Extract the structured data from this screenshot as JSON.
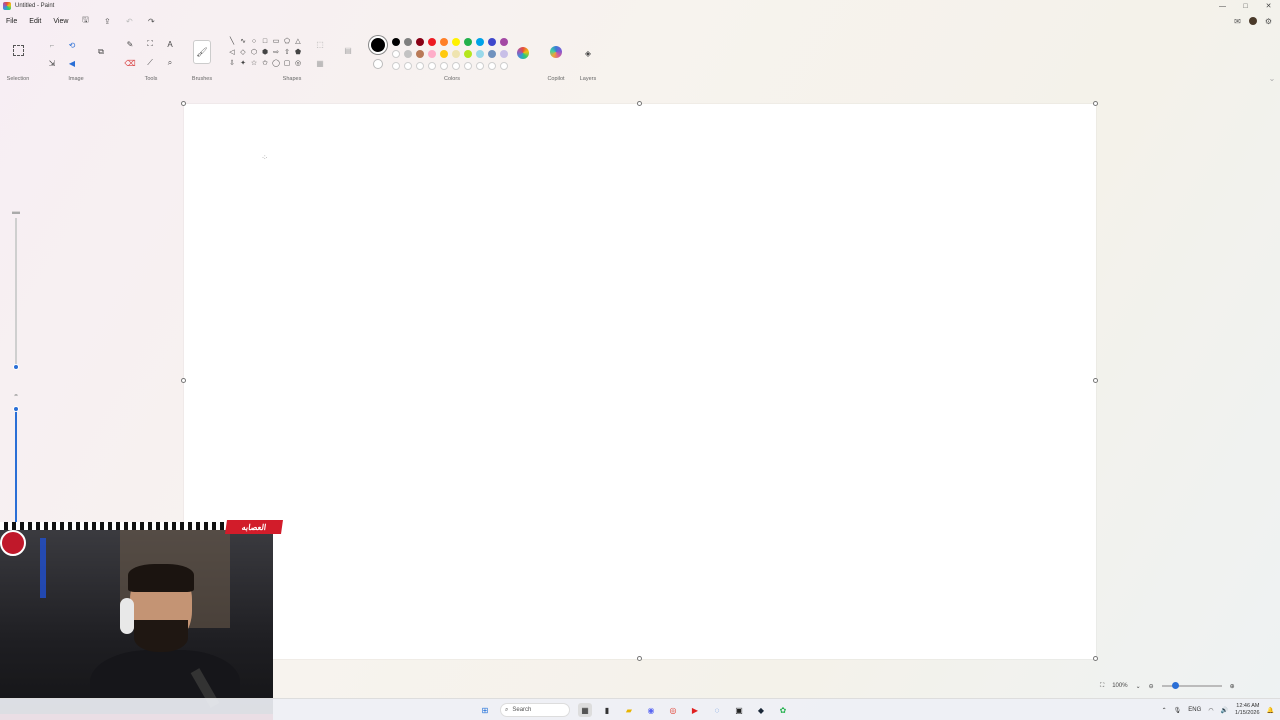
{
  "window": {
    "title": "Untitled - Paint",
    "min": "—",
    "max": "□",
    "close": "✕"
  },
  "menu": {
    "file": "File",
    "edit": "Edit",
    "view": "View"
  },
  "ribbon": {
    "groups": {
      "selection": "Selection",
      "image": "Image",
      "tools": "Tools",
      "brushes": "Brushes",
      "shapes": "Shapes",
      "colors": "Colors",
      "copilot": "Copilot",
      "layers": "Layers"
    },
    "active_color": "#000000",
    "palette_row1": [
      "#000000",
      "#7f7f7f",
      "#880015",
      "#ed1c24",
      "#ff7f27",
      "#fff200",
      "#22b14c",
      "#00a2e8",
      "#3f48cc",
      "#a349a4"
    ],
    "palette_row2": [
      "#ffffff",
      "#c3c3c3",
      "#b97a57",
      "#ffaec9",
      "#ffc90e",
      "#efe4b0",
      "#b5e61d",
      "#99d9ea",
      "#7092be",
      "#c8bfe7"
    ],
    "shapes_glyphs": [
      "╲",
      "∿",
      "○",
      "□",
      "▭",
      "⬠",
      "△",
      "◁",
      "◇",
      "⬡",
      "⬢",
      "⇨",
      "⇧",
      "⬟",
      "⇩",
      "✦",
      "☆",
      "✩",
      "◯",
      "▢",
      "◎"
    ]
  },
  "webcam": {
    "banner": "العصابه"
  },
  "status": {
    "zoom": "100%"
  },
  "taskbar": {
    "search_placeholder": "Search",
    "lang": "ENG",
    "time": "12:46 AM",
    "date": "1/15/2026"
  }
}
